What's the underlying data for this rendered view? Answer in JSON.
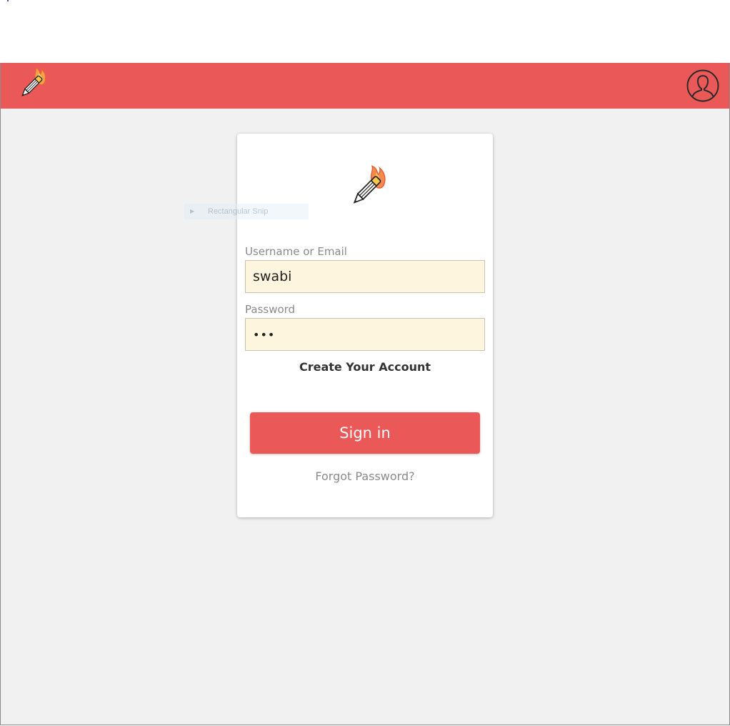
{
  "header": {
    "logo_icon": "flaming-pencil-icon",
    "profile_icon": "user-profile-icon",
    "color": "#eb5858"
  },
  "overlay": {
    "snip_label": "Rectangular Snip"
  },
  "login": {
    "logo_icon": "flaming-pencil-icon",
    "username_label": "Username or Email",
    "username_value": "swabi",
    "password_label": "Password",
    "password_value": "•••",
    "create_account": "Create Your Account",
    "sign_in": "Sign in",
    "forgot_password": "Forgot Password?"
  },
  "colors": {
    "accent": "#eb5858",
    "input_bg": "#fdf5de",
    "page_bg": "#f1f1f1"
  }
}
